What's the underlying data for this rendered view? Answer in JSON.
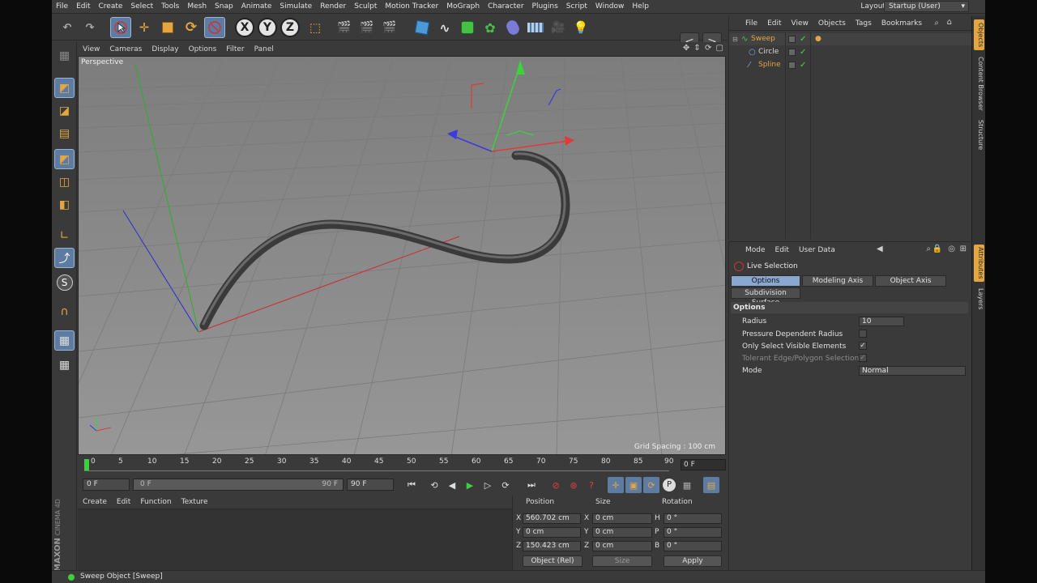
{
  "menubar": {
    "items": [
      "File",
      "Edit",
      "Create",
      "Select",
      "Tools",
      "Mesh",
      "Snap",
      "Animate",
      "Simulate",
      "Render",
      "Sculpt",
      "Motion Tracker",
      "MoGraph",
      "Character",
      "Plugins",
      "Script",
      "Window",
      "Help"
    ],
    "layout_label": "Layout:",
    "layout_value": "Startup (User)"
  },
  "toolbar": {
    "axis_x": "X",
    "axis_y": "Y",
    "axis_z": "Z",
    "nav_back": "<",
    "nav_forward": ">"
  },
  "viewport": {
    "menu": [
      "View",
      "Cameras",
      "Display",
      "Options",
      "Filter",
      "Panel"
    ],
    "camera_label": "Perspective",
    "grid_spacing": "Grid Spacing : 100 cm",
    "object_name": "Sweep"
  },
  "timeline": {
    "ticks": [
      "0",
      "5",
      "10",
      "15",
      "20",
      "25",
      "30",
      "35",
      "40",
      "45",
      "50",
      "55",
      "60",
      "65",
      "70",
      "75",
      "80",
      "85",
      "90"
    ],
    "current_frame": "0 F",
    "start_field": "0 F",
    "range_start": "0 F",
    "range_end": "90 F",
    "end_field": "90 F"
  },
  "materials": {
    "menu": [
      "Create",
      "Edit",
      "Function",
      "Texture"
    ],
    "brand_top": "MAXON",
    "brand_bottom": "CINEMA 4D"
  },
  "coordinates": {
    "headers": {
      "position": "Position",
      "size": "Size",
      "rotation": "Rotation"
    },
    "rows": [
      {
        "axis": "X",
        "position": "560.702 cm",
        "size_axis": "X",
        "size": "0 cm",
        "rot_axis": "H",
        "rotation": "0 °"
      },
      {
        "axis": "Y",
        "position": "0 cm",
        "size_axis": "Y",
        "size": "0 cm",
        "rot_axis": "P",
        "rotation": "0 °"
      },
      {
        "axis": "Z",
        "position": "150.423 cm",
        "size_axis": "Z",
        "size": "0 cm",
        "rot_axis": "B",
        "rotation": "0 °"
      }
    ],
    "mode_select": "Object (Rel)",
    "size_select": "Size",
    "apply": "Apply"
  },
  "status": {
    "text": "Sweep Object [Sweep]",
    "dot_color": "#3fce3f"
  },
  "object_manager": {
    "menu": [
      "File",
      "Edit",
      "View",
      "Objects",
      "Tags",
      "Bookmarks"
    ],
    "objects": [
      {
        "name": "Sweep",
        "color": "#e3a642",
        "icon": "sweep-icon"
      },
      {
        "name": "Circle",
        "color": "#e0e0e0",
        "icon": "circle-icon"
      },
      {
        "name": "Spline",
        "color": "#e3a642",
        "icon": "spline-icon"
      }
    ]
  },
  "right_tabs": [
    "Objects",
    "Content Browser",
    "Structure",
    "Attributes",
    "Layers"
  ],
  "attributes": {
    "menu": [
      "Mode",
      "Edit",
      "User Data"
    ],
    "tool_title": "Live Selection",
    "tabs": [
      "Options",
      "Modeling Axis",
      "Object Axis",
      "Subdivision Surface"
    ],
    "section": "Options",
    "params": [
      {
        "label": "Radius",
        "value": "10"
      },
      {
        "label": "Pressure Dependent Radius",
        "value": ""
      },
      {
        "label": "Only Select Visible Elements",
        "value": "✓"
      },
      {
        "label": "Tolerant Edge/Polygon Selection",
        "value": "✓"
      },
      {
        "label": "Mode",
        "value": "Normal"
      }
    ]
  },
  "colors": {
    "accent": "#e3a642",
    "selection": "#5e7ca2",
    "active_tab": "#8aa8cf"
  }
}
